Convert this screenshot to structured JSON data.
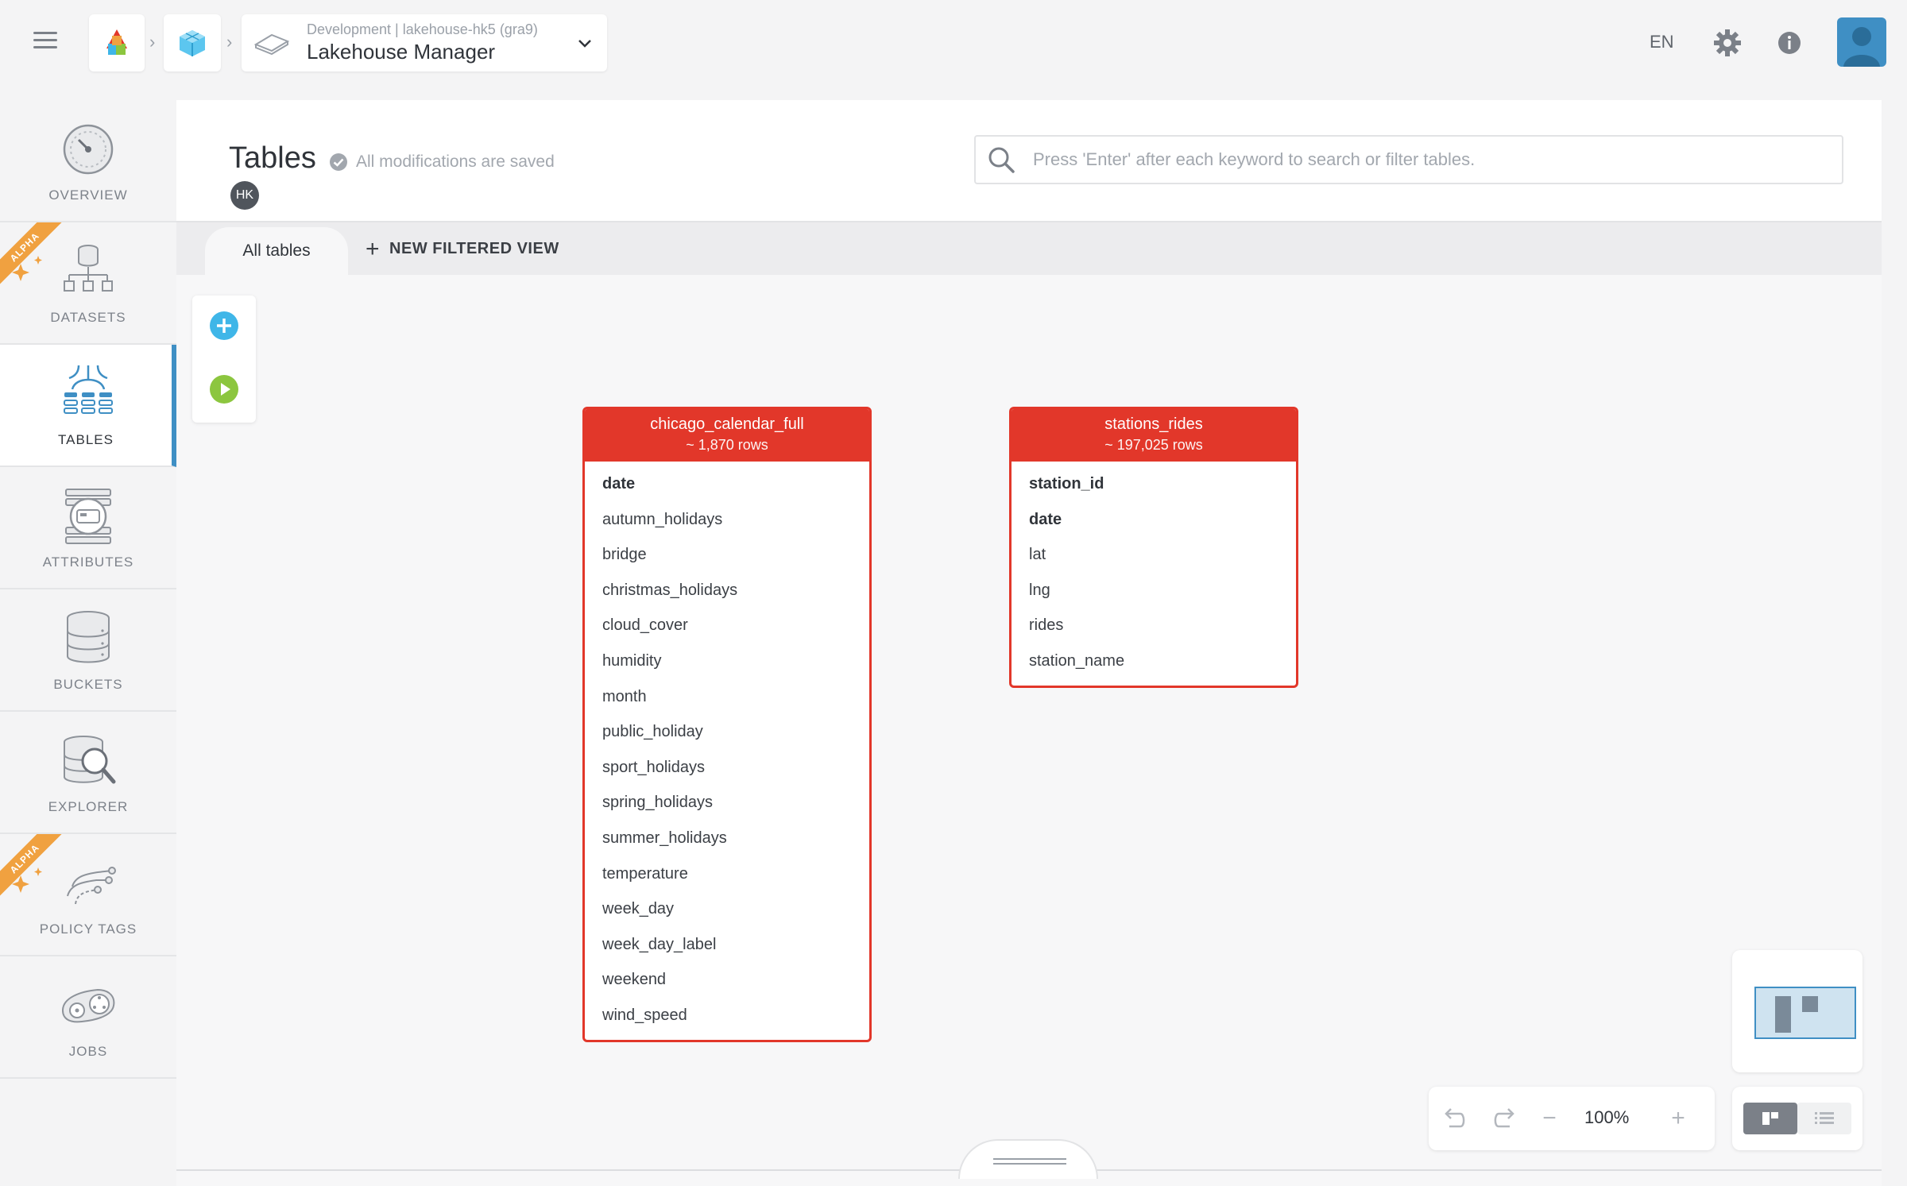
{
  "topbar": {
    "project_env": "Development | lakehouse-hk5 (gra9)",
    "project_name": "Lakehouse Manager",
    "language": "EN",
    "icons": [
      "menu-icon",
      "app-logo-icon",
      "cube-icon",
      "lakehouse-icon",
      "chevron-down-icon",
      "gear-icon",
      "info-icon",
      "user-avatar"
    ]
  },
  "sidebar": {
    "items": [
      {
        "label": "OVERVIEW",
        "icon": "gauge-icon",
        "alpha": false,
        "active": false
      },
      {
        "label": "DATASETS",
        "icon": "dataset-tree-icon",
        "alpha": true,
        "active": false
      },
      {
        "label": "TABLES",
        "icon": "tables-icon",
        "alpha": false,
        "active": true
      },
      {
        "label": "ATTRIBUTES",
        "icon": "attributes-icon",
        "alpha": false,
        "active": false
      },
      {
        "label": "BUCKETS",
        "icon": "database-icon",
        "alpha": false,
        "active": false
      },
      {
        "label": "EXPLORER",
        "icon": "database-search-icon",
        "alpha": false,
        "active": false
      },
      {
        "label": "POLICY TAGS",
        "icon": "policy-tags-icon",
        "alpha": true,
        "active": false
      },
      {
        "label": "JOBS",
        "icon": "jobs-icon",
        "alpha": false,
        "active": false
      }
    ],
    "alpha_label": "ALPHA"
  },
  "main": {
    "title": "Tables",
    "save_status": "All modifications are saved",
    "user_initials": "HK",
    "search_placeholder": "Press 'Enter' after each keyword to search or filter tables.",
    "tabs": {
      "all": "All tables",
      "new_view": "NEW FILTERED VIEW"
    }
  },
  "tables": [
    {
      "name": "chicago_calendar_full",
      "rows": "~ 1,870 rows",
      "columns": [
        {
          "name": "date",
          "key": true
        },
        {
          "name": "autumn_holidays",
          "key": false
        },
        {
          "name": "bridge",
          "key": false
        },
        {
          "name": "christmas_holidays",
          "key": false
        },
        {
          "name": "cloud_cover",
          "key": false
        },
        {
          "name": "humidity",
          "key": false
        },
        {
          "name": "month",
          "key": false
        },
        {
          "name": "public_holiday",
          "key": false
        },
        {
          "name": "sport_holidays",
          "key": false
        },
        {
          "name": "spring_holidays",
          "key": false
        },
        {
          "name": "summer_holidays",
          "key": false
        },
        {
          "name": "temperature",
          "key": false
        },
        {
          "name": "week_day",
          "key": false
        },
        {
          "name": "week_day_label",
          "key": false
        },
        {
          "name": "weekend",
          "key": false
        },
        {
          "name": "wind_speed",
          "key": false
        }
      ]
    },
    {
      "name": "stations_rides",
      "rows": "~ 197,025 rows",
      "columns": [
        {
          "name": "station_id",
          "key": true
        },
        {
          "name": "date",
          "key": true
        },
        {
          "name": "lat",
          "key": false
        },
        {
          "name": "lng",
          "key": false
        },
        {
          "name": "rides",
          "key": false
        },
        {
          "name": "station_name",
          "key": false
        }
      ]
    }
  ],
  "zoom": {
    "level": "100%"
  },
  "colors": {
    "accent": "#3f8fc4",
    "table_header": "#e2372a",
    "alpha": "#f0a140",
    "add": "#3fb6e8",
    "run": "#8cc63f"
  }
}
